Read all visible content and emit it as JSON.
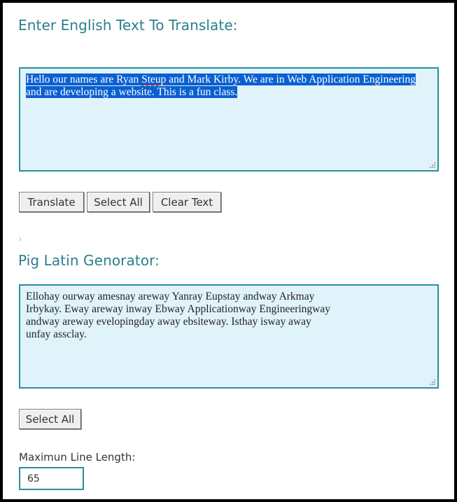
{
  "input_section": {
    "heading": "Enter English Text To Translate:",
    "text_line1": "Hello our names are Ryan ",
    "text_spell": "Steup",
    "text_line1b": " and Mark Kirby. We are in Web Application Engineering",
    "text_line2": "and are developing a website. This is a fun class."
  },
  "buttons": {
    "translate": "Translate",
    "select_all": "Select All",
    "clear_text": "Clear Text"
  },
  "chevron": "›",
  "output_section": {
    "heading": "Pig Latin Genorator:",
    "lines": [
      "Ellohay ourway amesnay areway Yanray Eupstay andway Arkmay",
      "Irbykay. Eway areway inway Ebway Applicationway Engineeringway",
      "andway areway evelopingday away ebsiteway. Isthay isway away",
      "unfay assclay."
    ],
    "select_all": "Select All"
  },
  "line_length": {
    "label": "Maximun Line Length:",
    "value": "65"
  },
  "colors": {
    "accent": "#2a7f8c",
    "textarea_bg": "#e0f3fb",
    "selection": "#0a60d0"
  }
}
